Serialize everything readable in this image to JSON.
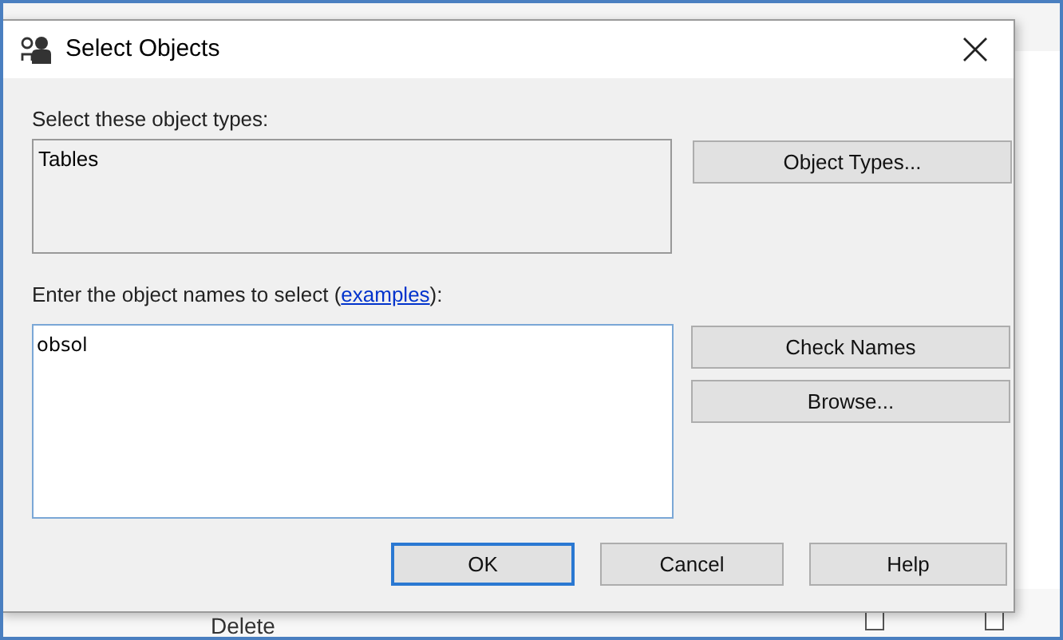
{
  "background": {
    "bottom_row": [
      "Delete"
    ],
    "checkboxes": [
      {
        "checked": false
      },
      {
        "checked": false
      }
    ]
  },
  "dialog": {
    "title": "Select Objects",
    "types_label": "Select these object types:",
    "types_value": "Tables",
    "object_types_button": "Object Types...",
    "names_label": {
      "before": "Enter the object names to select (",
      "link": "examples",
      "after": "):"
    },
    "names_value": "obsol",
    "side_buttons": [
      "Check Names",
      "Browse..."
    ],
    "buttons": [
      {
        "label": "OK",
        "default": true
      },
      {
        "label": "Cancel",
        "default": false
      },
      {
        "label": "Help",
        "default": false
      }
    ]
  }
}
